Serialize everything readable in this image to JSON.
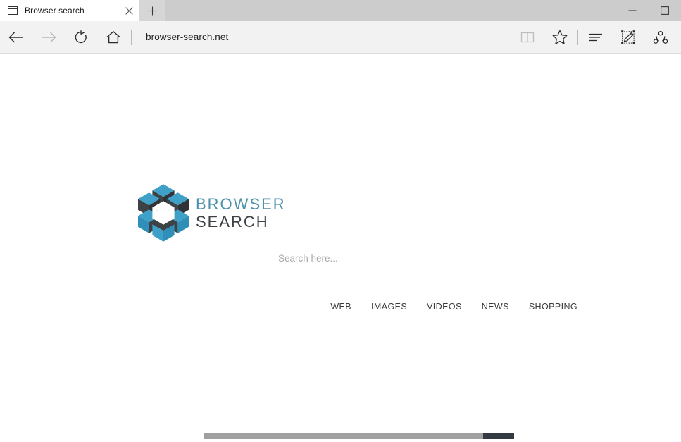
{
  "window": {
    "tab": {
      "title": "Browser search",
      "favicon_icon": "window-icon",
      "close_icon": "close-icon"
    },
    "new_tab_label": "+",
    "controls": {
      "minimize_label": "—",
      "maximize_label": "□"
    }
  },
  "toolbar": {
    "back_icon": "back-arrow-icon",
    "forward_icon": "forward-arrow-icon",
    "refresh_icon": "refresh-icon",
    "home_icon": "home-icon",
    "url": "browser-search.net",
    "reading_view_icon": "reading-view-icon",
    "favorites_icon": "star-icon",
    "hub_icon": "hub-icon",
    "web_note_icon": "web-note-pencil-icon",
    "share_icon": "share-icon"
  },
  "page": {
    "logo": {
      "line1": "BROWSER",
      "line2": "SEARCH",
      "blue": "#4b8fa8",
      "dark": "#3d4247"
    },
    "search": {
      "placeholder": "Search here...",
      "value": ""
    },
    "nav": [
      {
        "label": "WEB"
      },
      {
        "label": "IMAGES"
      },
      {
        "label": "VIDEOS"
      },
      {
        "label": "NEWS"
      },
      {
        "label": "SHOPPING"
      }
    ]
  }
}
